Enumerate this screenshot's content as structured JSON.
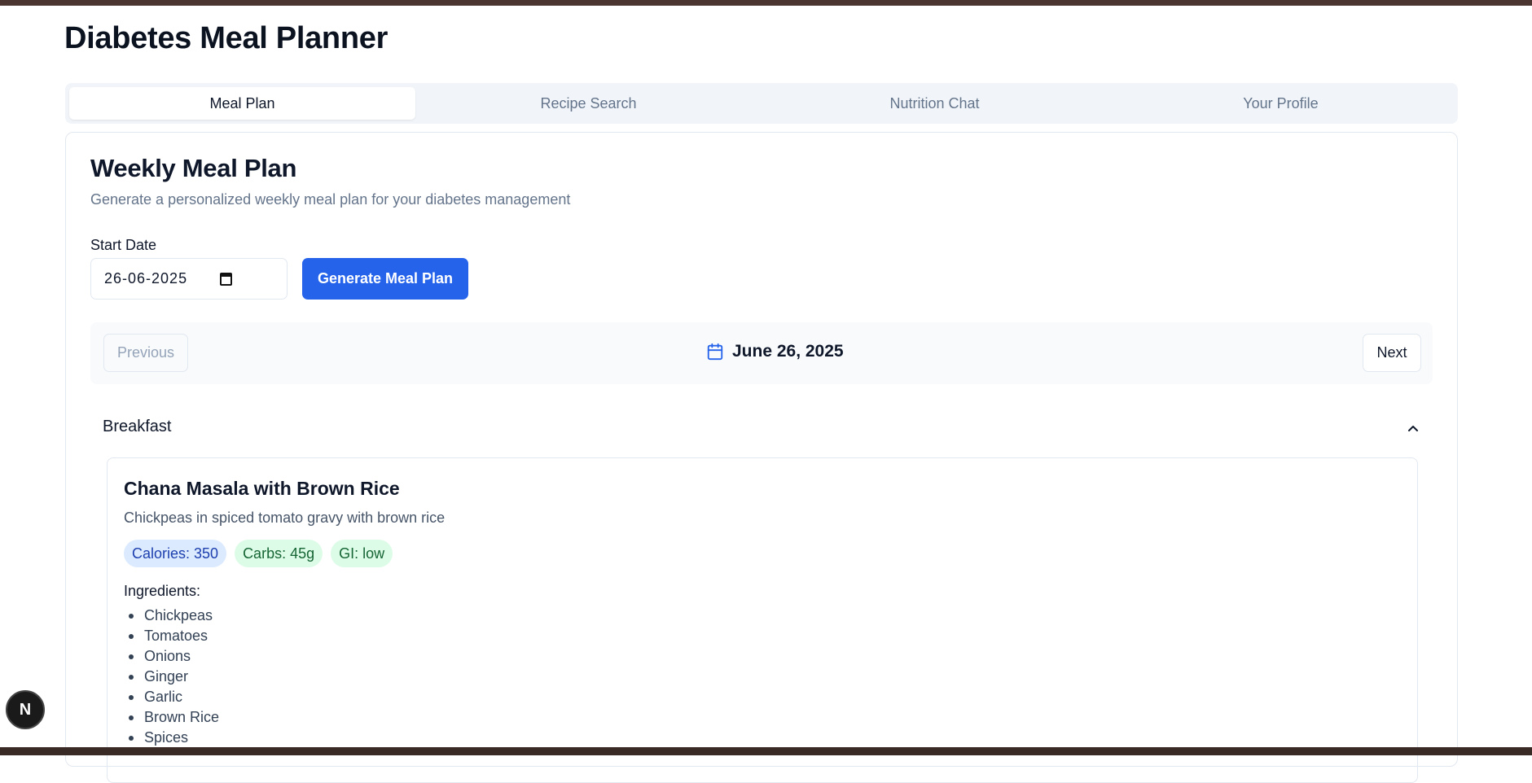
{
  "app": {
    "title": "Diabetes Meal Planner"
  },
  "tabs": [
    {
      "label": "Meal Plan",
      "active": true
    },
    {
      "label": "Recipe Search",
      "active": false
    },
    {
      "label": "Nutrition Chat",
      "active": false
    },
    {
      "label": "Your Profile",
      "active": false
    }
  ],
  "meal_plan": {
    "title": "Weekly Meal Plan",
    "description": "Generate a personalized weekly meal plan for your diabetes management",
    "start_date_label": "Start Date",
    "start_date_value": "26-06-2025",
    "generate_label": "Generate Meal Plan",
    "nav": {
      "previous_label": "Previous",
      "next_label": "Next",
      "current_date": "June 26, 2025"
    },
    "section": {
      "title": "Breakfast",
      "meal": {
        "name": "Chana Masala with Brown Rice",
        "description": "Chickpeas in spiced tomato gravy with brown rice",
        "badges": {
          "calories": "Calories: 350",
          "carbs": "Carbs: 45g",
          "gi": "GI: low"
        },
        "ingredients_label": "Ingredients:",
        "ingredients": [
          "Chickpeas",
          "Tomatoes",
          "Onions",
          "Ginger",
          "Garlic",
          "Brown Rice",
          "Spices"
        ]
      }
    }
  },
  "dev_badge": {
    "letter": "N"
  },
  "colors": {
    "primary": "#2563eb",
    "tab_bg": "#f1f5f9",
    "badge_blue": "#dbeafe",
    "badge_green": "#dcfce7"
  }
}
